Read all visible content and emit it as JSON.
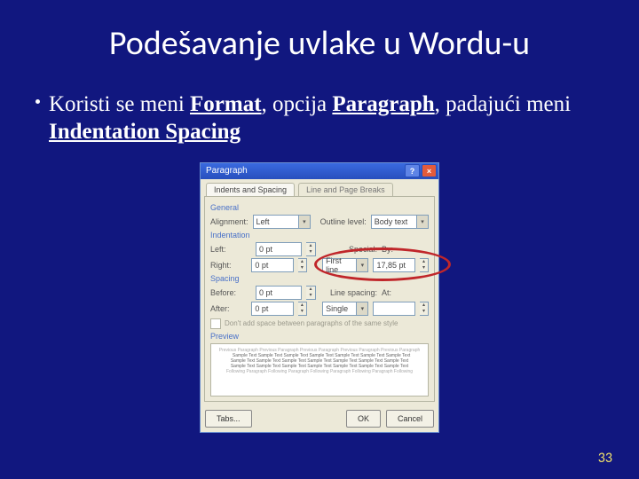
{
  "title": "Podešavanje uvlake u Wordu-u",
  "bullet": {
    "pre": "Koristi se meni ",
    "format": "Format",
    "mid1": ", opcija ",
    "paragraph": "Paragraph",
    "mid2": ", padajući meni ",
    "indentation": "Indentation Spacing"
  },
  "dialog": {
    "title": "Paragraph",
    "help": "?",
    "close": "×",
    "tab1": "Indents and Spacing",
    "tab2": "Line and Page Breaks",
    "sections": {
      "general": "General",
      "indentation": "Indentation",
      "spacing": "Spacing",
      "preview": "Preview"
    },
    "labels": {
      "alignment": "Alignment:",
      "outline": "Outline level:",
      "left": "Left:",
      "right": "Right:",
      "special": "Special:",
      "by": "By:",
      "before": "Before:",
      "after": "After:",
      "linespacing": "Line spacing:",
      "at": "At:"
    },
    "values": {
      "alignment": "Left",
      "outline": "Body text",
      "left": "0 pt",
      "right": "0 pt",
      "special": "First line",
      "by": "17,85 pt",
      "before": "0 pt",
      "after": "0 pt",
      "linespacing": "Single",
      "at": ""
    },
    "checkbox": "Don't add space between paragraphs of the same style",
    "buttons": {
      "tabs": "Tabs...",
      "ok": "OK",
      "cancel": "Cancel"
    }
  },
  "pagenum": "33"
}
